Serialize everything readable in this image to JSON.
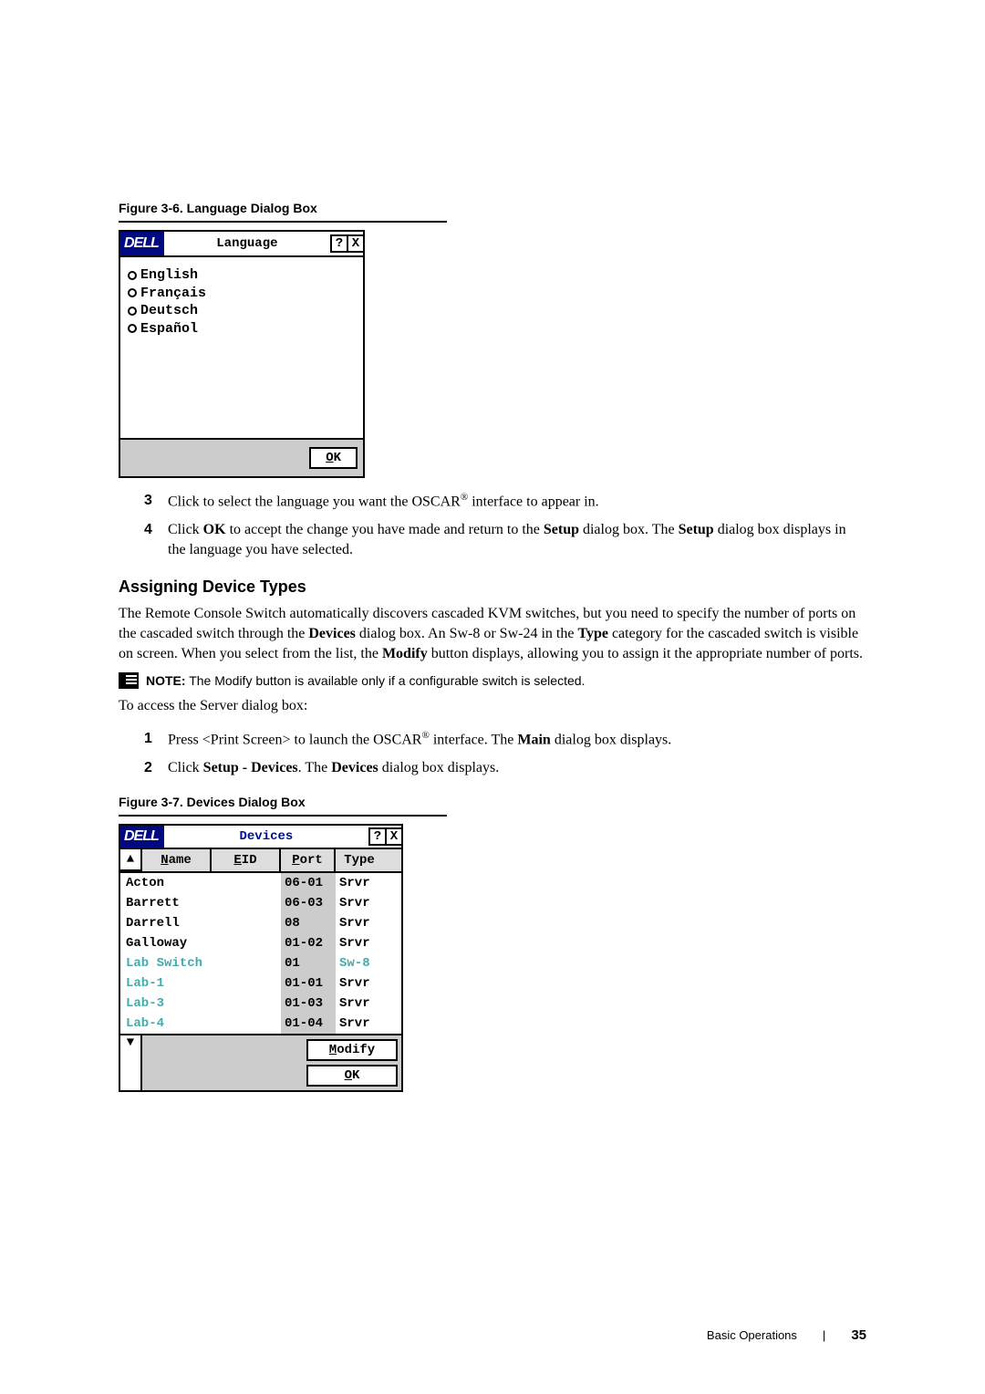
{
  "fig6": {
    "caption": "Figure 3-6.   Language Dialog Box",
    "title": "Language",
    "logo": "DELL",
    "help": "?",
    "close": "X",
    "languages": [
      "English",
      "Français",
      "Deutsch",
      "Español"
    ],
    "ok_u": "O",
    "ok_rest": "K"
  },
  "steps_a": {
    "3": {
      "pre": "Click to select the language you want the OSCAR",
      "reg": "®",
      "post": " interface to appear in."
    },
    "4": {
      "pre": "Click ",
      "b1": "OK",
      "mid": " to accept the change you have made and return to the ",
      "b2": "Setup",
      "post1": " dialog box. The ",
      "b3": "Setup",
      "post2": " dialog box displays in the language you have selected."
    }
  },
  "assign_heading": "Assigning Device Types",
  "assign_para": {
    "t1": "The Remote Console Switch automatically discovers cascaded KVM switches, but you need to specify the number of ports on the cascaded switch through the ",
    "b1": "Devices",
    "t2": " dialog box. An Sw-8 or Sw-24 in the ",
    "b2": "Type",
    "t3": " category for the cascaded switch is visible on screen. When you select from the list, the ",
    "b3": "Modify",
    "t4": " button displays, allowing you to assign it the appropriate number of ports."
  },
  "note": {
    "label": "NOTE:",
    "text": " The Modify button is available only if a configurable switch is selected."
  },
  "access_line": "To access the Server dialog box:",
  "steps_b": {
    "1": {
      "t1": "Press <Print Screen> to launch the OSCAR",
      "reg": "®",
      "t2": " interface. The ",
      "b1": "Main",
      "t3": " dialog box displays."
    },
    "2": {
      "t1": "Click ",
      "b1": "Setup - Devices",
      "t2": ". The ",
      "b2": "Devices",
      "t3": " dialog box displays."
    }
  },
  "fig7": {
    "caption": "Figure 3-7.   Devices Dialog Box",
    "title": "Devices",
    "logo": "DELL",
    "help": "?",
    "close": "X",
    "up": "▲",
    "down": "▼",
    "hdr_name_u": "N",
    "hdr_name_rest": "ame",
    "hdr_eid_u": "E",
    "hdr_eid_rest": "ID",
    "hdr_port_u": "P",
    "hdr_port_rest": "ort",
    "hdr_type": "Type",
    "rows": [
      {
        "name": "Acton",
        "port": "06-01",
        "type": "Srvr",
        "hl": false,
        "swhl": false
      },
      {
        "name": "Barrett",
        "port": "06-03",
        "type": "Srvr",
        "hl": false,
        "swhl": false
      },
      {
        "name": "Darrell",
        "port": "08",
        "type": "Srvr",
        "hl": false,
        "swhl": false
      },
      {
        "name": "Galloway",
        "port": "01-02",
        "type": "Srvr",
        "hl": false,
        "swhl": false
      },
      {
        "name": "Lab Switch",
        "port": "01",
        "type": "Sw-8",
        "hl": true,
        "swhl": true
      },
      {
        "name": "Lab-1",
        "port": "01-01",
        "type": "Srvr",
        "hl": true,
        "swhl": false
      },
      {
        "name": "Lab-3",
        "port": "01-03",
        "type": "Srvr",
        "hl": true,
        "swhl": false
      },
      {
        "name": "Lab-4",
        "port": "01-04",
        "type": "Srvr",
        "hl": true,
        "swhl": false
      }
    ],
    "modify_u": "M",
    "modify_rest": "odify",
    "ok_u": "O",
    "ok_rest": "K"
  },
  "footer": {
    "section": "Basic Operations",
    "pagenum": "35"
  }
}
